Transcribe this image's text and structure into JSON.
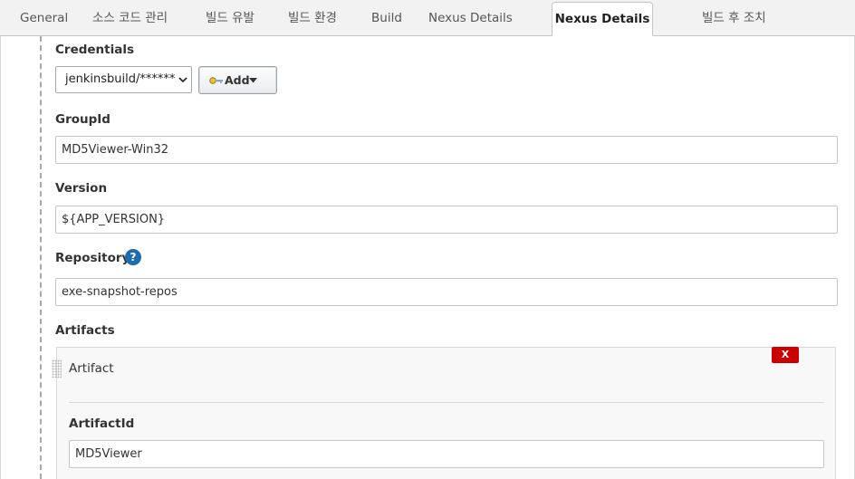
{
  "tabs": [
    {
      "label": "General"
    },
    {
      "label": "소스 코드 관리"
    },
    {
      "label": "빌드 유발"
    },
    {
      "label": "빌드 환경"
    },
    {
      "label": "Build"
    },
    {
      "label": "Nexus Details"
    },
    {
      "label": "Nexus Details"
    },
    {
      "label": "빌드 후 조치"
    }
  ],
  "active_tab_index": 6,
  "form": {
    "credentials": {
      "label": "Credentials",
      "selected": "jenkinsbuild/******",
      "add_label": "Add",
      "key_icon": "key-icon"
    },
    "groupid": {
      "label": "GroupId",
      "value": "MD5Viewer-Win32"
    },
    "version": {
      "label": "Version",
      "value": "${APP_VERSION}"
    },
    "repository": {
      "label": "Repository",
      "help": "?",
      "value": "exe-snapshot-repos"
    },
    "artifacts": {
      "label": "Artifacts",
      "item": {
        "title": "Artifact",
        "delete_label": "X",
        "artifactid": {
          "label": "ArtifactId",
          "value": "MD5Viewer"
        }
      }
    }
  },
  "colors": {
    "delete": "#cc0000",
    "help": "#1d6cae"
  }
}
